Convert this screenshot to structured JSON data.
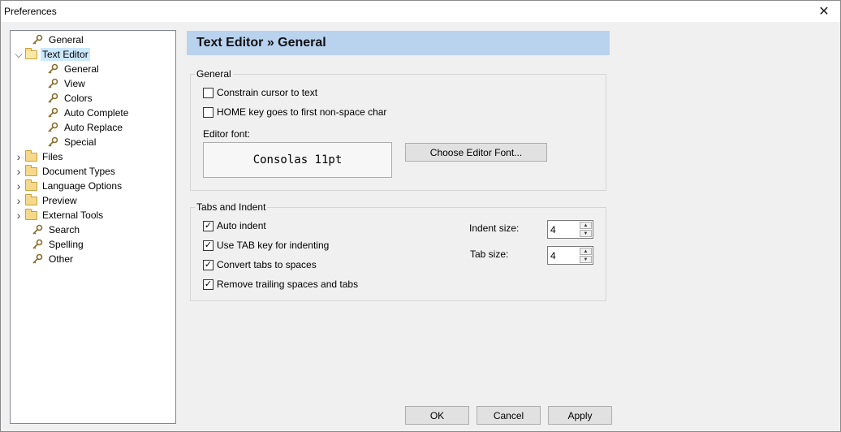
{
  "window": {
    "title": "Preferences",
    "close_glyph": "✕"
  },
  "tree": {
    "items": [
      {
        "label": "General",
        "icon": "key-icon",
        "level": 1,
        "expander": ""
      },
      {
        "label": "Text Editor",
        "icon": "folder-open-icon",
        "level": 0,
        "expander": "expanded",
        "selected": true
      },
      {
        "label": "General",
        "icon": "key-icon",
        "level": 2,
        "expander": ""
      },
      {
        "label": "View",
        "icon": "key-icon",
        "level": 2,
        "expander": ""
      },
      {
        "label": "Colors",
        "icon": "key-icon",
        "level": 2,
        "expander": ""
      },
      {
        "label": "Auto Complete",
        "icon": "key-icon",
        "level": 2,
        "expander": ""
      },
      {
        "label": "Auto Replace",
        "icon": "key-icon",
        "level": 2,
        "expander": ""
      },
      {
        "label": "Special",
        "icon": "key-icon",
        "level": 2,
        "expander": ""
      },
      {
        "label": "Files",
        "icon": "folder-icon",
        "level": 0,
        "expander": "collapsed"
      },
      {
        "label": "Document Types",
        "icon": "folder-icon",
        "level": 0,
        "expander": "collapsed"
      },
      {
        "label": "Language Options",
        "icon": "folder-icon",
        "level": 0,
        "expander": "collapsed"
      },
      {
        "label": "Preview",
        "icon": "folder-icon",
        "level": 0,
        "expander": "collapsed"
      },
      {
        "label": "External Tools",
        "icon": "folder-icon",
        "level": 0,
        "expander": "collapsed"
      },
      {
        "label": "Search",
        "icon": "key-icon",
        "level": 1,
        "expander": ""
      },
      {
        "label": "Spelling",
        "icon": "key-icon",
        "level": 1,
        "expander": ""
      },
      {
        "label": "Other",
        "icon": "key-icon",
        "level": 1,
        "expander": ""
      }
    ]
  },
  "header": {
    "title": "Text Editor » General"
  },
  "general_group": {
    "title": "General",
    "constrain_cursor": {
      "label": "Constrain cursor to text",
      "checked": false
    },
    "home_key": {
      "label": "HOME key goes to first non-space char",
      "checked": false
    },
    "editor_font_label": "Editor font:",
    "editor_font_value": "Consolas 11pt",
    "choose_font_button": "Choose Editor Font..."
  },
  "tabs_group": {
    "title": "Tabs and Indent",
    "auto_indent": {
      "label": "Auto indent",
      "checked": true
    },
    "use_tab": {
      "label": "Use TAB key for indenting",
      "checked": true
    },
    "convert_tabs": {
      "label": "Convert tabs to spaces",
      "checked": true
    },
    "remove_trailing": {
      "label": "Remove trailing spaces and tabs",
      "checked": true
    },
    "indent_size_label": "Indent size:",
    "indent_size_value": "4",
    "tab_size_label": "Tab size:",
    "tab_size_value": "4"
  },
  "footer": {
    "ok": "OK",
    "cancel": "Cancel",
    "apply": "Apply"
  },
  "colors": {
    "header_bg": "#b9d3ef",
    "selection_bg": "#cce8ff",
    "folder": "#f5d88a"
  }
}
